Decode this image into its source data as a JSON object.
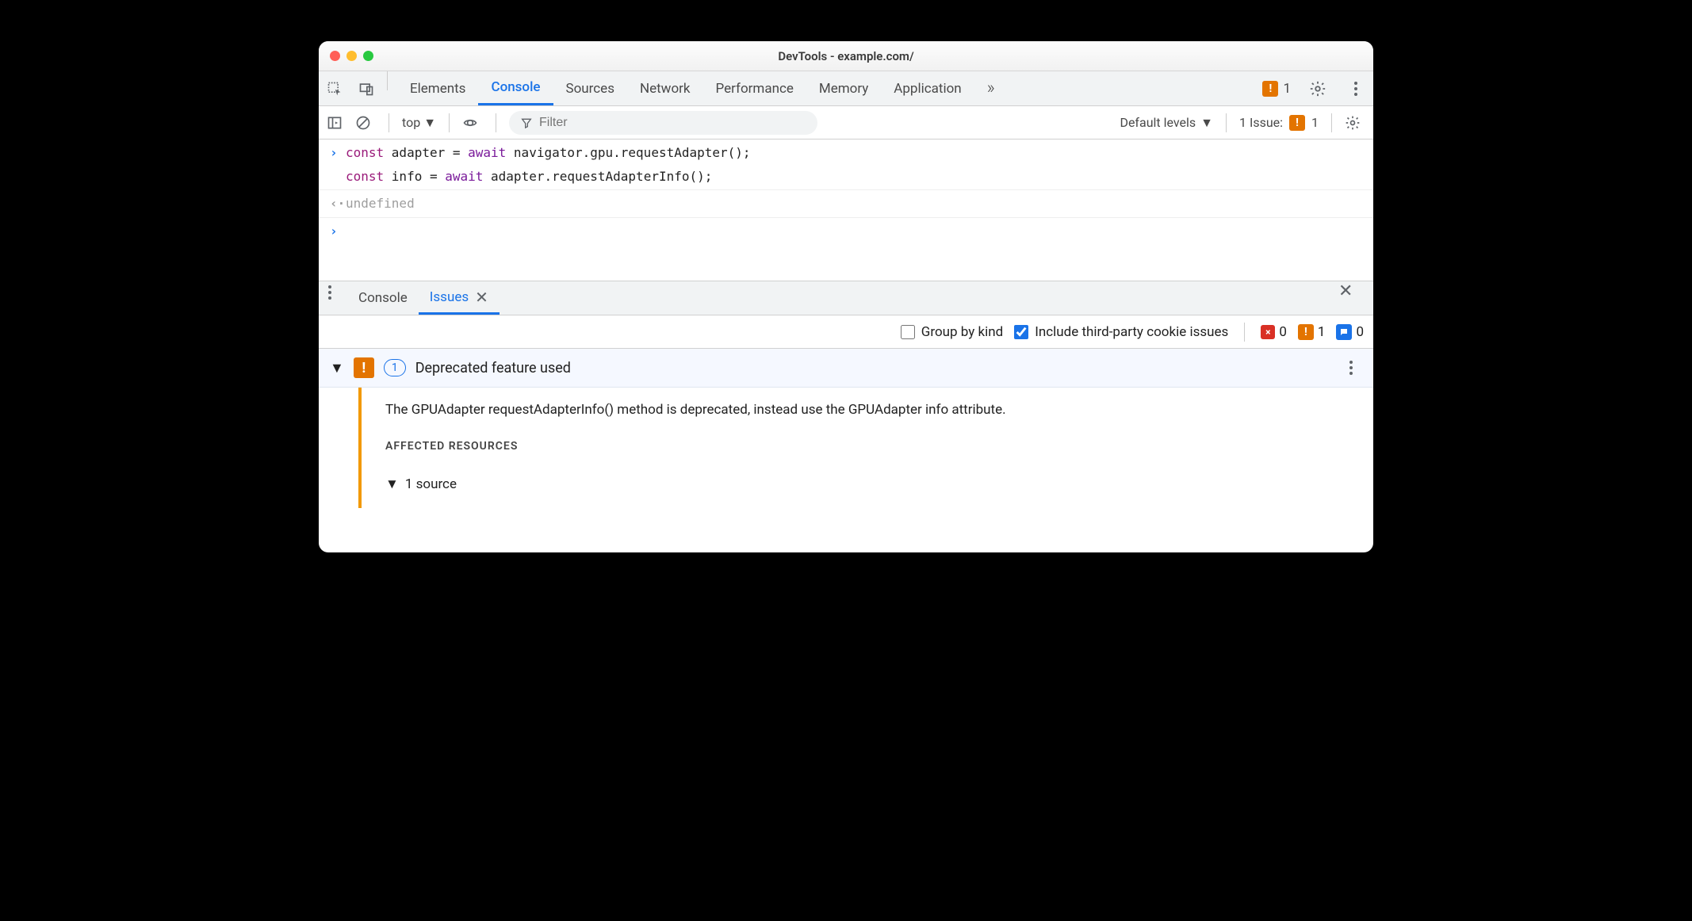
{
  "titlebar": {
    "title": "DevTools - example.com/"
  },
  "tabs": {
    "items": [
      "Elements",
      "Console",
      "Sources",
      "Network",
      "Performance",
      "Memory",
      "Application"
    ],
    "active": "Console",
    "overflow": "»",
    "warn_count": "1"
  },
  "toolbar": {
    "context": "top",
    "filter_placeholder": "Filter",
    "levels": "Default levels",
    "issues_label": "1 Issue:",
    "issues_count": "1"
  },
  "console": {
    "lines": [
      {
        "prefix": ">",
        "segments": [
          {
            "t": "const ",
            "c": "kw"
          },
          {
            "t": "adapter = "
          },
          {
            "t": "await ",
            "c": "kw2"
          },
          {
            "t": "navigator.gpu.requestAdapter();"
          }
        ]
      },
      {
        "prefix": "",
        "segments": [
          {
            "t": "const ",
            "c": "kw"
          },
          {
            "t": "info = "
          },
          {
            "t": "await ",
            "c": "kw2"
          },
          {
            "t": "adapter.requestAdapterInfo();"
          }
        ]
      }
    ],
    "output": {
      "prefix": "<·",
      "text": "undefined"
    },
    "prompt": ">"
  },
  "drawer": {
    "tabs": [
      "Console",
      "Issues"
    ],
    "active": "Issues"
  },
  "issues_toolbar": {
    "group_by_kind": "Group by kind",
    "group_checked": false,
    "include_3p": "Include third-party cookie issues",
    "include_checked": true,
    "errors": "0",
    "warnings": "1",
    "infos": "0"
  },
  "issue": {
    "count": "1",
    "title": "Deprecated feature used",
    "message": "The GPUAdapter requestAdapterInfo() method is deprecated, instead use the GPUAdapter info attribute.",
    "section": "AFFECTED RESOURCES",
    "sources": "1 source"
  }
}
